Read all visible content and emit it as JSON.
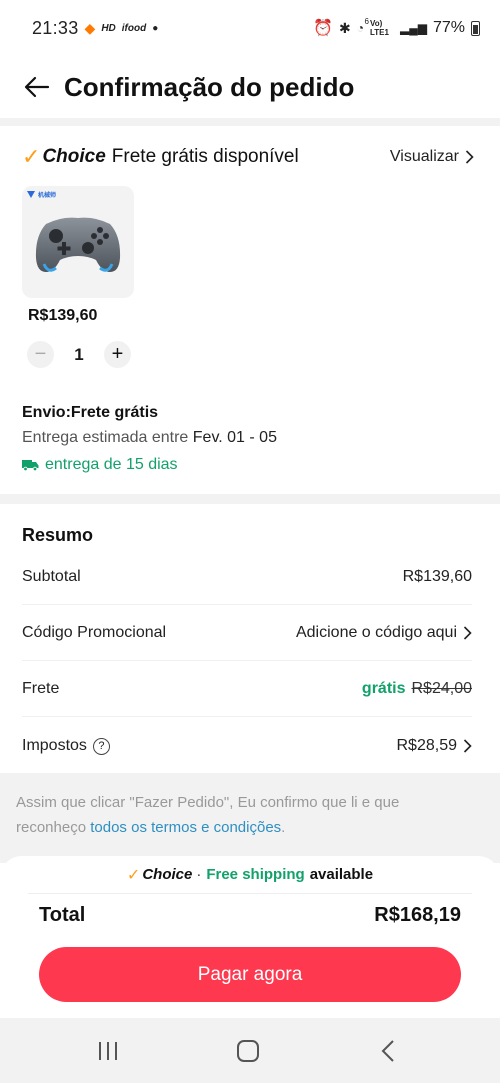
{
  "status_bar": {
    "time": "21:33",
    "hd_label": "HD",
    "ifood_label": "ifood",
    "network": "Vo) LTE1",
    "signal_gen": "6",
    "battery": "77%"
  },
  "header": {
    "title": "Confirmação do pedido"
  },
  "store": {
    "choice_label": "Choice",
    "shipping_text": "Frete grátis disponível",
    "view_label": "Visualizar"
  },
  "product": {
    "image_alt": "controle de videogame",
    "brand_text": "机械师",
    "price": "R$139,60",
    "quantity": "1"
  },
  "shipping": {
    "title": "Envio:Frete grátis",
    "estimate_label": "Entrega estimada entre",
    "estimate_dates": "Fev. 01 - 05",
    "days_label": "entrega de 15 dias"
  },
  "summary": {
    "title": "Resumo",
    "subtotal_label": "Subtotal",
    "subtotal_value": "R$139,60",
    "promo_label": "Código Promocional",
    "promo_action": "Adicione o código aqui",
    "shipping_label": "Frete",
    "shipping_free": "grátis",
    "shipping_original": "R$24,00",
    "taxes_label": "Impostos",
    "taxes_value": "R$28,59"
  },
  "terms": {
    "text": "Assim que clicar \"Fazer Pedido\", Eu confirmo que li e que reconheço",
    "link": "todos os termos e condições",
    "end": "."
  },
  "banner": {
    "choice_label": "Choice",
    "separator": "·",
    "free_shipping": "Free shipping",
    "available": "available"
  },
  "total": {
    "label": "Total",
    "value": "R$168,19"
  },
  "pay_button": {
    "label": "Pagar agora"
  },
  "colors": {
    "accent_red": "#fd384f",
    "green": "#13a16b",
    "choice_orange": "#ff9e1b",
    "link_blue": "#2f8fc2"
  },
  "icons": [
    "back-arrow-icon",
    "chevron-right-icon",
    "minus-icon",
    "plus-icon",
    "truck-icon",
    "help-icon",
    "recent-apps-icon",
    "home-icon",
    "back-nav-icon",
    "alarm-icon",
    "bluetooth-icon",
    "wifi-icon",
    "signal-icon",
    "battery-icon"
  ]
}
